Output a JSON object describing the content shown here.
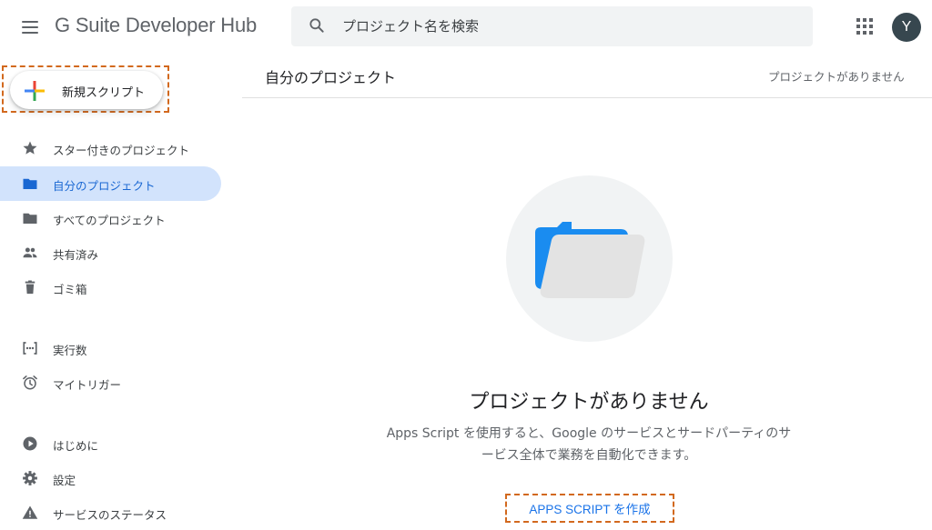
{
  "header": {
    "brand": "G Suite Developer Hub",
    "search_placeholder": "プロジェクト名を検索",
    "avatar_letter": "Y"
  },
  "sidebar": {
    "new_button_label": "新規スクリプト",
    "items": [
      {
        "label": "スター付きのプロジェクト",
        "icon": "star-icon"
      },
      {
        "label": "自分のプロジェクト",
        "icon": "folder-icon",
        "active": true
      },
      {
        "label": "すべてのプロジェクト",
        "icon": "folder-icon"
      },
      {
        "label": "共有済み",
        "icon": "people-icon"
      },
      {
        "label": "ゴミ箱",
        "icon": "trash-icon"
      },
      {
        "label": "実行数",
        "icon": "executions-icon"
      },
      {
        "label": "マイトリガー",
        "icon": "alarm-clock-icon"
      },
      {
        "label": "はじめに",
        "icon": "play-circle-icon"
      },
      {
        "label": "設定",
        "icon": "gear-icon"
      },
      {
        "label": "サービスのステータス",
        "icon": "warning-icon"
      }
    ]
  },
  "main": {
    "title": "自分のプロジェクト",
    "status": "プロジェクトがありません",
    "empty_title": "プロジェクトがありません",
    "empty_description_line1": "Apps Script を使用すると、Google のサービスとサードパーティのサ",
    "empty_description_line2": "ービス全体で業務を自動化できます。",
    "create_link": "APPS SCRIPT を作成"
  },
  "colors": {
    "accent": "#1a73e8",
    "active_nav_bg": "#d2e3fc",
    "highlight_dash": "#d2691e",
    "folder_blue": "#1a8cf0"
  }
}
